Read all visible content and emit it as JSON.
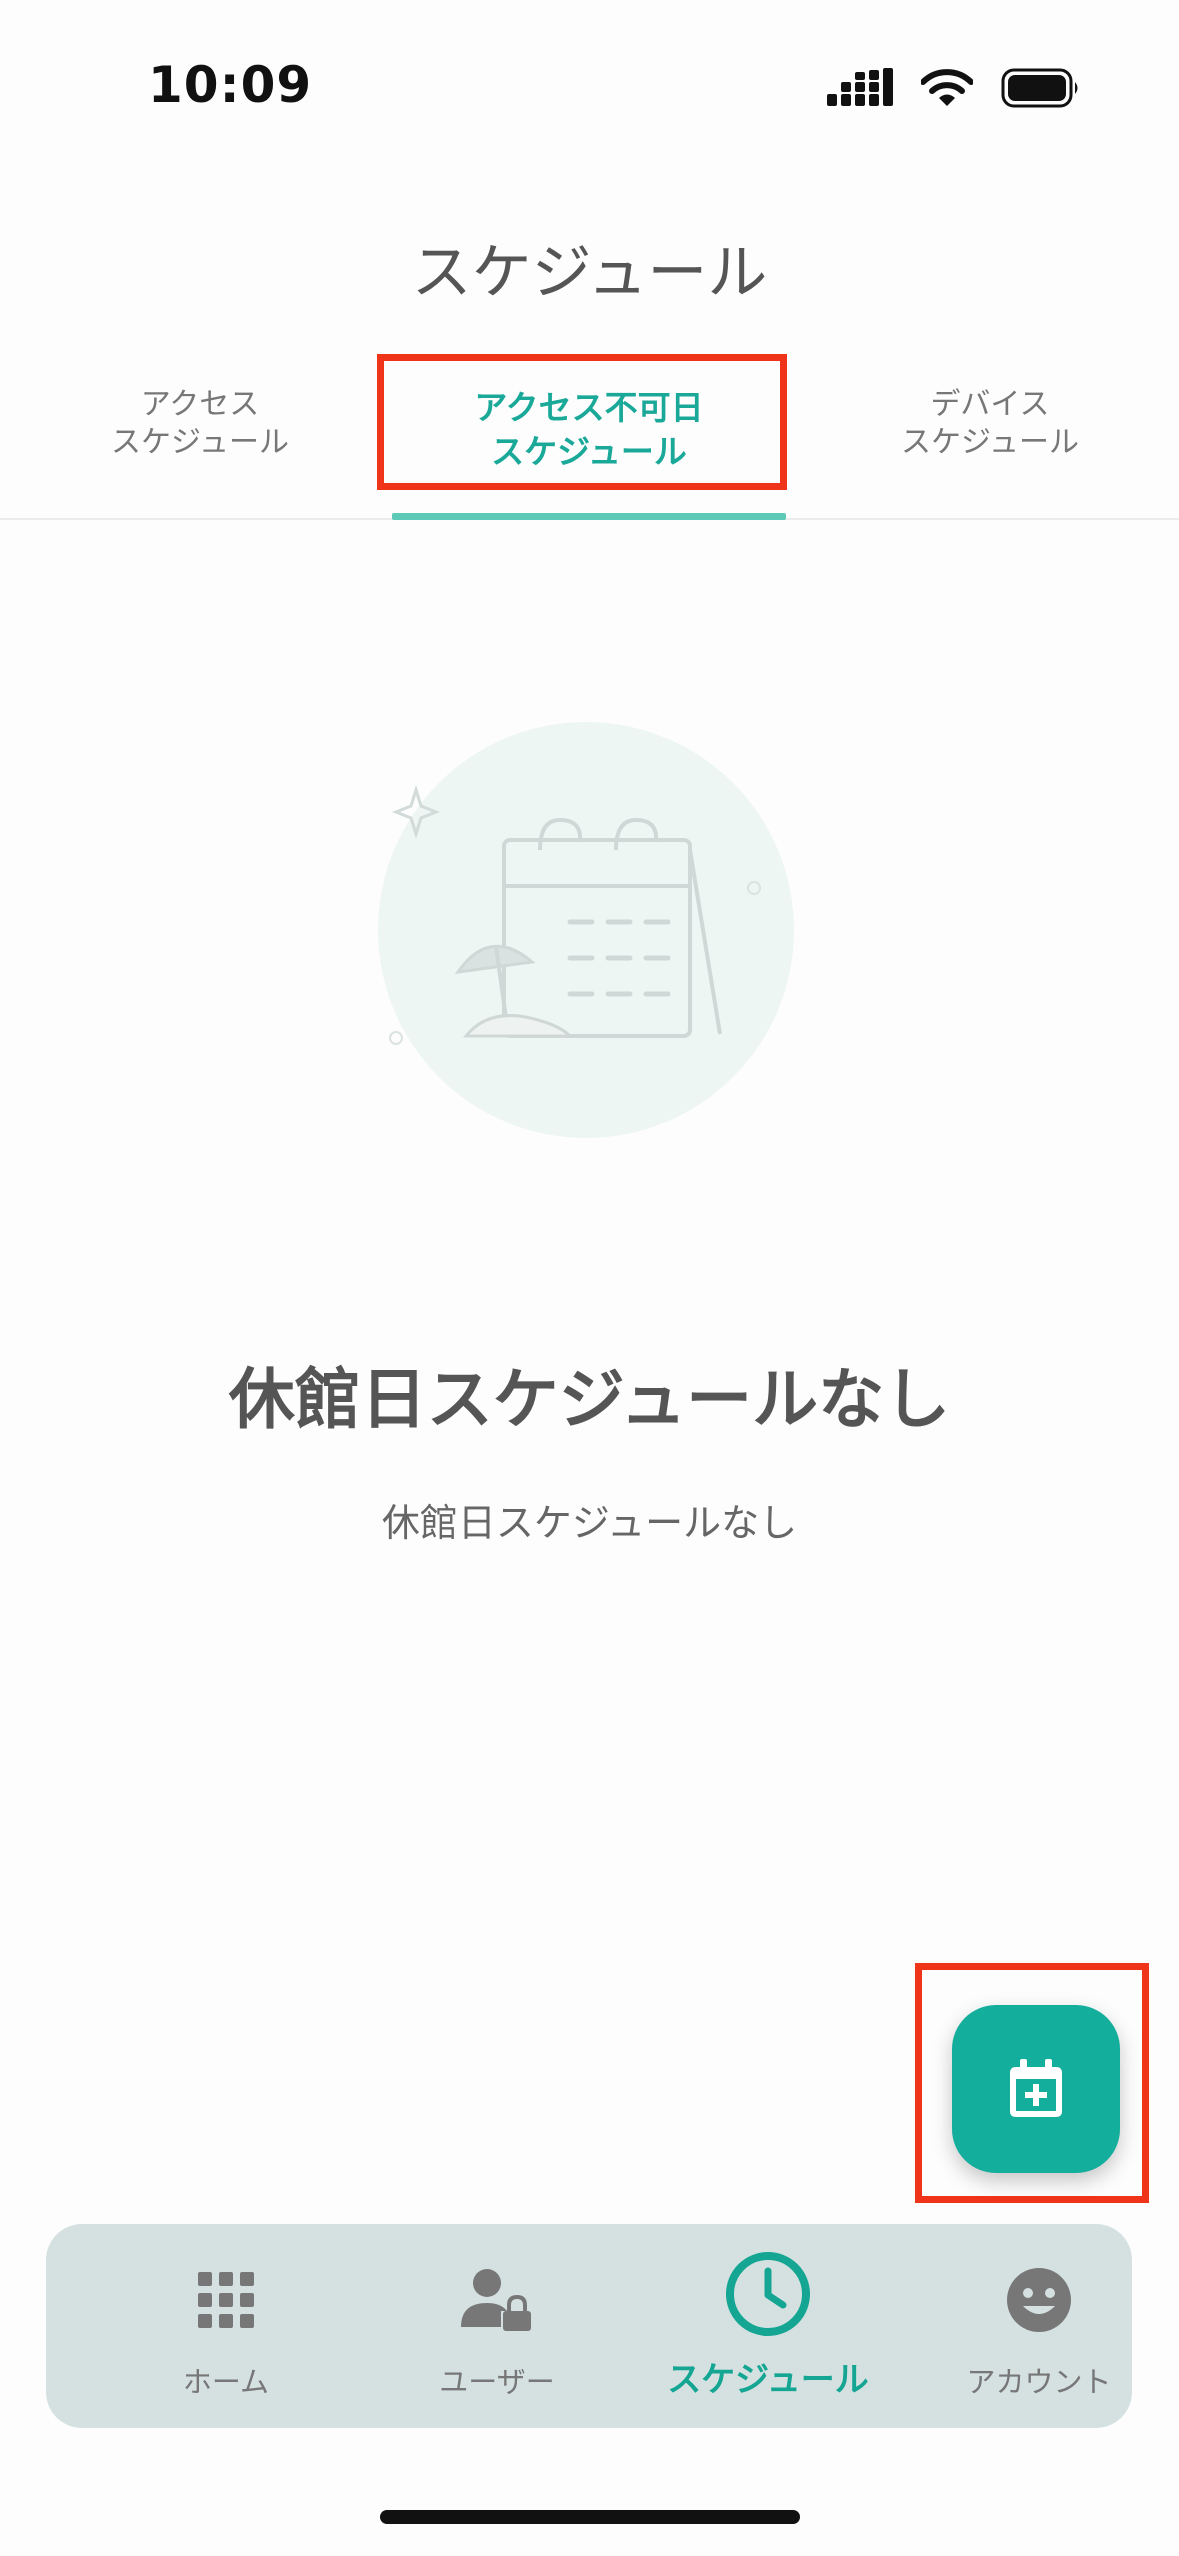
{
  "status_bar": {
    "time": "10:09"
  },
  "page": {
    "title": "スケジュール"
  },
  "tabs": [
    {
      "line1": "アクセス",
      "line2": "スケジュール"
    },
    {
      "line1": "アクセス不可日",
      "line2": "スケジュール"
    },
    {
      "line1": "デバイス",
      "line2": "スケジュール"
    }
  ],
  "empty_state": {
    "title": "休館日スケジュールなし",
    "subtitle": "休館日スケジュールなし"
  },
  "fab": {
    "icon": "calendar-add-icon"
  },
  "nav": [
    {
      "label": "ホーム",
      "icon": "grid-icon"
    },
    {
      "label": "ユーザー",
      "icon": "user-lock-icon"
    },
    {
      "label": "スケジュール",
      "icon": "clock-icon"
    },
    {
      "label": "アカウント",
      "icon": "smiley-icon"
    }
  ],
  "colors": {
    "accent": "#14ae9d",
    "highlight": "#f0341a",
    "nav_bg": "#d5e1e1"
  }
}
